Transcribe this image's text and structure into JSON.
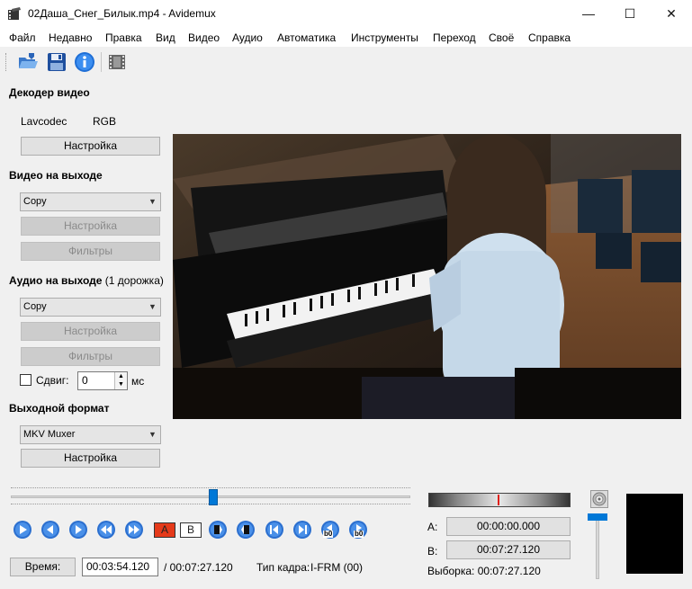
{
  "window": {
    "title": "02Даша_Снег_Билык.mp4 - Avidemux",
    "minimize_glyph": "—",
    "maximize_glyph": "☐",
    "close_glyph": "✕"
  },
  "menu": [
    "Файл",
    "Недавно",
    "Правка",
    "Вид",
    "Видео",
    "Аудио",
    "Автоматика",
    "Инструменты",
    "Переход",
    "Своё",
    "Справка"
  ],
  "toolbar": {
    "icons": [
      "open-folder-icon",
      "save-disk-icon",
      "info-icon",
      "film-properties-icon"
    ]
  },
  "decoder": {
    "title": "Декодер видео",
    "codec": "Lavcodec",
    "colorspace": "RGB",
    "config_label": "Настройка"
  },
  "video_out": {
    "title": "Видео на выходе",
    "codec": "Copy",
    "config_label": "Настройка",
    "filters_label": "Фильтры"
  },
  "audio_out": {
    "title": "Аудио на выходе",
    "tracks": "(1 дорожка)",
    "codec": "Copy",
    "config_label": "Настройка",
    "filters_label": "Фильтры",
    "shift_label": "Сдвиг:",
    "shift_value": "0",
    "shift_unit": "мс"
  },
  "output_format": {
    "title": "Выходной формат",
    "muxer": "MKV Muxer",
    "config_label": "Настройка"
  },
  "timeline": {
    "position_fraction": 0.508
  },
  "controls": {
    "buttons": [
      "play",
      "prev-frame",
      "next-frame",
      "rewind",
      "fast-forward",
      "set-marker-a",
      "set-marker-b",
      "prev-cut-point",
      "next-cut-point",
      "go-to-start",
      "go-to-end",
      "prev-black-frame",
      "next-black-frame"
    ],
    "marker_a_label": "A",
    "marker_b_label": "B",
    "black_frame_label": "b0"
  },
  "status": {
    "time_button_label": "Время:",
    "current_time": "00:03:54.120",
    "total_time": "/ 00:07:27.120",
    "frame_type_label": "Тип кадра:",
    "frame_type_value": "I-FRM (00)"
  },
  "selection": {
    "a_label": "A:",
    "a_value": "00:00:00.000",
    "b_label": "B:",
    "b_value": "00:07:27.120",
    "duration_label": "Выборка:",
    "duration_value": "00:07:27.120"
  },
  "volume": {
    "icon": "speaker-icon"
  }
}
